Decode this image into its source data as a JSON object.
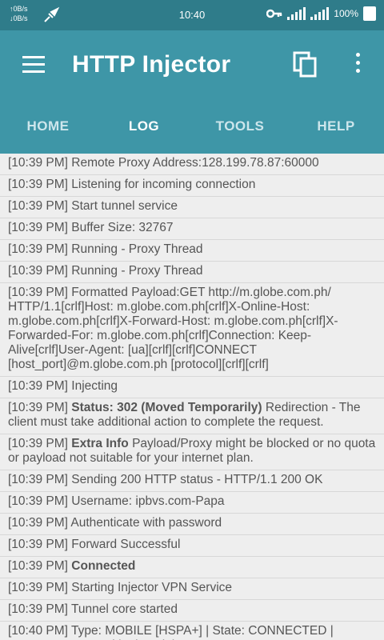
{
  "status_bar": {
    "net_up": "↑0B/s",
    "net_down": "↓0B/s",
    "time": "10:40",
    "battery": "100%"
  },
  "app_bar": {
    "title": "HTTP Injector"
  },
  "tabs": [
    "HOME",
    "LOG",
    "TOOLS",
    "HELP"
  ],
  "active_tab": "LOG",
  "log": [
    {
      "ts": "[10:39 PM]",
      "bold": "",
      "text": "Remote Proxy Address:128.199.78.87:60000"
    },
    {
      "ts": "[10:39 PM]",
      "bold": "",
      "text": "Listening for incoming connection"
    },
    {
      "ts": "[10:39 PM]",
      "bold": "",
      "text": "Start tunnel service"
    },
    {
      "ts": "[10:39 PM]",
      "bold": "",
      "text": "Buffer Size: 32767"
    },
    {
      "ts": "[10:39 PM]",
      "bold": "",
      "text": "Running - Proxy Thread"
    },
    {
      "ts": "[10:39 PM]",
      "bold": "",
      "text": "Running - Proxy Thread"
    },
    {
      "ts": "[10:39 PM]",
      "bold": "",
      "text": "Formatted Payload:GET http://m.globe.com.ph/ HTTP/1.1[crlf]Host: m.globe.com.ph[crlf]X-Online-Host: m.globe.com.ph[crlf]X-Forward-Host: m.globe.com.ph[crlf]X-Forwarded-For: m.globe.com.ph[crlf]Connection: Keep-Alive[crlf]User-Agent: [ua][crlf][crlf]CONNECT [host_port]@m.globe.com.ph [protocol][crlf][crlf]"
    },
    {
      "ts": "[10:39 PM]",
      "bold": "",
      "text": "Injecting"
    },
    {
      "ts": "[10:39 PM]",
      "bold": "Status: 302 (Moved Temporarily)",
      "text": "Redirection - The client must take additional action to complete the request."
    },
    {
      "ts": "[10:39 PM]",
      "bold": "Extra Info",
      "text": "Payload/Proxy might be blocked or no quota or payload not suitable for your internet plan."
    },
    {
      "ts": "[10:39 PM]",
      "bold": "",
      "text": "Sending 200 HTTP status - HTTP/1.1 200 OK"
    },
    {
      "ts": "[10:39 PM]",
      "bold": "",
      "text": "Username: ipbvs.com-Papa"
    },
    {
      "ts": "[10:39 PM]",
      "bold": "",
      "text": "Authenticate with password"
    },
    {
      "ts": "[10:39 PM]",
      "bold": "",
      "text": "Forward Successful"
    },
    {
      "ts": "[10:39 PM]",
      "bold": "Connected",
      "text": ""
    },
    {
      "ts": "[10:39 PM]",
      "bold": "",
      "text": "Starting Injector VPN Service"
    },
    {
      "ts": "[10:39 PM]",
      "bold": "",
      "text": "Tunnel core started"
    },
    {
      "ts": "[10:40 PM]",
      "bold": "",
      "text": "Type: MOBILE [HSPA+] | State: CONNECTED | Reason: connected | telstra.iph"
    }
  ]
}
